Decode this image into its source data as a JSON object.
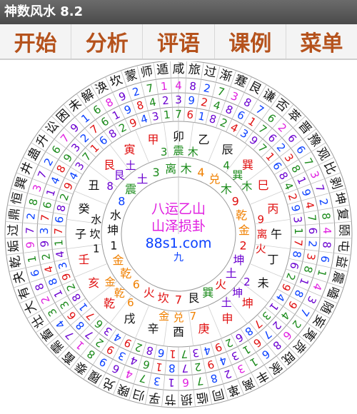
{
  "app": {
    "title": "神数风水 8.2"
  },
  "menu": [
    {
      "label": "开始"
    },
    {
      "label": "分析"
    },
    {
      "label": "评语"
    },
    {
      "label": "课例"
    },
    {
      "label": "菜单"
    }
  ],
  "center": {
    "line1": "八运乙山",
    "line2": "山泽损卦",
    "line3": "88s1.com",
    "marker": "九"
  },
  "colors": {
    "magenta": "#e020e0",
    "red": "#e01010",
    "green": "#1a8a1a",
    "purple": "#6a00d0",
    "blue": "#0a40ff",
    "orange": "#f08000",
    "black": "#111111"
  },
  "rings": {
    "gua": [
      "咸",
      "旅",
      "过",
      "渐",
      "蹇",
      "艮",
      "谦",
      "否",
      "萃",
      "晋",
      "豫",
      "观",
      "比",
      "剥",
      "坤",
      "复",
      "颐",
      "屯",
      "益",
      "震",
      "嗑",
      "随",
      "妄",
      "夷",
      "贲",
      "既",
      "家",
      "丰",
      "离",
      "革",
      "同",
      "临",
      "损",
      "节",
      "孚",
      "归",
      "睽",
      "兑",
      "履",
      "泰",
      "畜",
      "需",
      "畜",
      "壮",
      "大",
      "有",
      "夬",
      "乾",
      "姤",
      "过",
      "鼎",
      "恒",
      "巽",
      "井",
      "蛊",
      "升",
      "讼",
      "困",
      "未",
      "解",
      "涣",
      "坎",
      "蒙",
      "师",
      "遁"
    ],
    "num_outer": [
      "4",
      "8",
      "2",
      "7",
      "3",
      "8",
      "7",
      "6",
      "2",
      "6",
      "6",
      "7",
      "3",
      "7",
      "2",
      "8",
      "4",
      "8",
      "6",
      "1",
      "4",
      "3",
      "7",
      "2",
      "6",
      "8",
      "6",
      "1",
      "3",
      "2",
      "8",
      "7",
      "6",
      "1",
      "3",
      "7",
      "4",
      "6",
      "9",
      "8",
      "1",
      "7",
      "4",
      "3",
      "2",
      "8",
      "6",
      "1",
      "9",
      "7",
      "2",
      "8",
      "3",
      "7",
      "2",
      "6",
      "7",
      "9",
      "1",
      "6",
      "8",
      "9",
      "2",
      "7",
      "1"
    ],
    "num_mid": [
      "3",
      "9",
      "2",
      "4",
      "8",
      "6",
      "1",
      "7",
      "6",
      "2",
      "3",
      "8",
      "1",
      "9",
      "4",
      "7",
      "6",
      "2",
      "3",
      "8",
      "1",
      "8",
      "9",
      "4",
      "2",
      "7",
      "6",
      "1",
      "3",
      "4",
      "9",
      "2",
      "7",
      "8",
      "1",
      "6",
      "4",
      "3",
      "9",
      "2",
      "7",
      "8",
      "6",
      "3",
      "1",
      "8",
      "4",
      "2",
      "9",
      "3",
      "7",
      "6",
      "1",
      "4",
      "8",
      "9",
      "3",
      "2",
      "7",
      "6",
      "1",
      "9",
      "8",
      "4",
      "2"
    ],
    "num_inner": [
      "7",
      "6",
      "1",
      "8",
      "2",
      "4",
      "3",
      "9",
      "7",
      "1",
      "6",
      "8",
      "4",
      "2",
      "9",
      "3",
      "1",
      "7",
      "8",
      "6",
      "2",
      "9",
      "4",
      "1",
      "3",
      "7",
      "8",
      "6",
      "2",
      "9",
      "4",
      "3",
      "7",
      "1",
      "6",
      "8",
      "2",
      "9",
      "4",
      "3",
      "6",
      "7",
      "1",
      "8",
      "2",
      "9",
      "3",
      "4",
      "1",
      "7",
      "6",
      "8",
      "2",
      "9",
      "4",
      "3",
      "7",
      "1",
      "6",
      "8",
      "2",
      "9",
      "4",
      "3",
      "1"
    ],
    "gan_zhi": [
      {
        "t": "酉",
        "c": "black"
      },
      {
        "t": "辛",
        "c": "black"
      },
      {
        "t": "戌",
        "c": "black"
      },
      {
        "t": "乾",
        "c": "red"
      },
      {
        "t": "亥",
        "c": "red"
      },
      {
        "t": "壬",
        "c": "red"
      },
      {
        "t": "子",
        "c": "black"
      },
      {
        "t": "癸",
        "c": "black"
      },
      {
        "t": "丑",
        "c": "black"
      },
      {
        "t": "艮",
        "c": "red"
      },
      {
        "t": "寅",
        "c": "red"
      },
      {
        "t": "甲",
        "c": "red"
      },
      {
        "t": "卯",
        "c": "black"
      },
      {
        "t": "乙",
        "c": "black"
      },
      {
        "t": "辰",
        "c": "black"
      },
      {
        "t": "巽",
        "c": "red"
      },
      {
        "t": "巳",
        "c": "red"
      },
      {
        "t": "丙",
        "c": "red"
      },
      {
        "t": "午",
        "c": "black"
      },
      {
        "t": "丁",
        "c": "black"
      },
      {
        "t": "未",
        "c": "black"
      },
      {
        "t": "坤",
        "c": "red"
      },
      {
        "t": "申",
        "c": "red"
      },
      {
        "t": "庚",
        "c": "red"
      }
    ],
    "palaces": [
      {
        "items": [
          {
            "t": "7",
            "c": "orange"
          },
          {
            "t": "兑",
            "c": "orange"
          },
          {
            "t": "金",
            "c": "orange"
          }
        ]
      },
      {
        "items": [
          {
            "t": "6",
            "c": "orange"
          },
          {
            "t": "乾",
            "c": "orange"
          },
          {
            "t": "金",
            "c": "orange"
          }
        ]
      },
      {
        "items": [
          {
            "t": "1",
            "c": "black"
          },
          {
            "t": "坎",
            "c": "black"
          },
          {
            "t": "水",
            "c": "black"
          }
        ]
      },
      {
        "items": [
          {
            "t": "8",
            "c": "purple"
          },
          {
            "t": "艮",
            "c": "purple"
          },
          {
            "t": "土",
            "c": "purple"
          }
        ]
      },
      {
        "items": [
          {
            "t": "3",
            "c": "green"
          },
          {
            "t": "震",
            "c": "green"
          },
          {
            "t": "木",
            "c": "green"
          }
        ]
      },
      {
        "items": [
          {
            "t": "4",
            "c": "green"
          },
          {
            "t": "巽",
            "c": "green"
          },
          {
            "t": "木",
            "c": "green"
          }
        ]
      },
      {
        "items": [
          {
            "t": "9",
            "c": "red"
          },
          {
            "t": "离",
            "c": "red"
          },
          {
            "t": "火",
            "c": "red"
          }
        ]
      },
      {
        "items": [
          {
            "t": "2",
            "c": "purple"
          },
          {
            "t": "坤",
            "c": "purple"
          },
          {
            "t": "土",
            "c": "purple"
          }
        ]
      }
    ],
    "flying_star": [
      {
        "t": "7",
        "c": "red"
      },
      {
        "t": "坎",
        "c": "red"
      },
      {
        "t": "火",
        "c": "red"
      },
      {
        "t": "6",
        "c": "orange"
      },
      {
        "t": "乾",
        "c": "orange"
      },
      {
        "t": "金",
        "c": "orange"
      },
      {
        "t": "1",
        "c": "black"
      },
      {
        "t": "坤",
        "c": "black"
      },
      {
        "t": "水",
        "c": "black"
      },
      {
        "t": "8",
        "c": "blue"
      },
      {
        "t": "震",
        "c": "green"
      },
      {
        "t": "土",
        "c": "purple"
      },
      {
        "t": "3",
        "c": "green"
      },
      {
        "t": "离",
        "c": "green"
      },
      {
        "t": "木",
        "c": "green"
      },
      {
        "t": "4",
        "c": "orange"
      },
      {
        "t": "兑",
        "c": "orange"
      },
      {
        "t": "木",
        "c": "green"
      },
      {
        "t": "9",
        "c": "red"
      },
      {
        "t": "乾",
        "c": "orange"
      },
      {
        "t": "金",
        "c": "orange"
      },
      {
        "t": "2",
        "c": "red"
      },
      {
        "t": "坤",
        "c": "purple"
      },
      {
        "t": "土",
        "c": "purple"
      },
      {
        "t": "火",
        "c": "red"
      },
      {
        "t": "巽",
        "c": "green"
      },
      {
        "t": "艮",
        "c": "black"
      }
    ]
  }
}
